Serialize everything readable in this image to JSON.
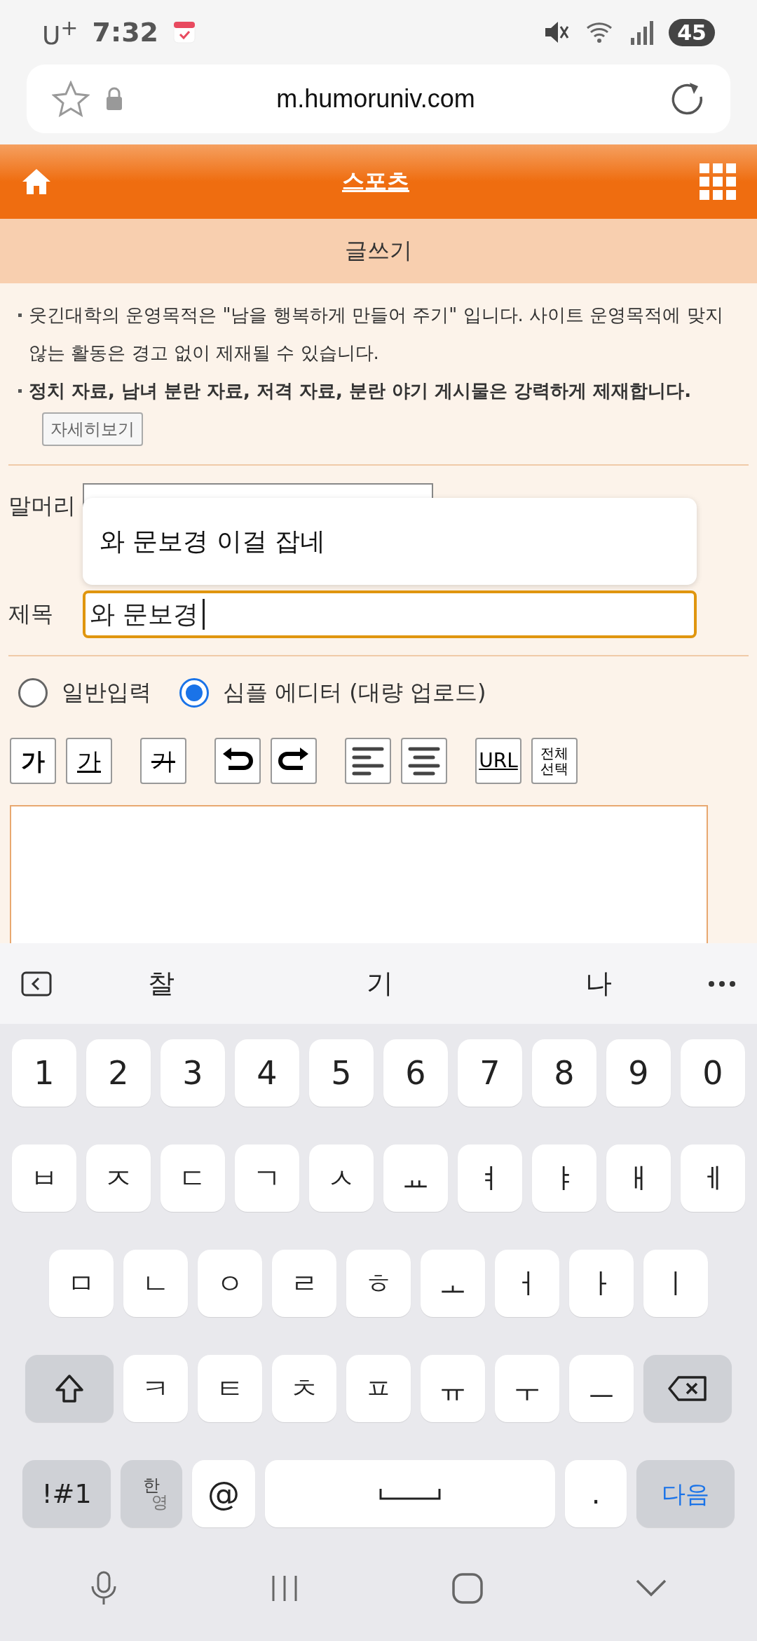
{
  "status_bar": {
    "carrier": "U$^{+}$",
    "time": "7:32",
    "battery": "45"
  },
  "browser": {
    "url": "m.humoruniv.com"
  },
  "header": {
    "title": "스포츠",
    "subtitle": "글쓰기"
  },
  "notices": [
    {
      "text": "웃긴대학의 운영목적은 \"남을 행복하게 만들어 주기\" 입니다. 사이트 운영목적에 맞지 않는 활동은 경고 없이 제재될 수 있습니다.",
      "bold": false
    },
    {
      "text": "정치 자료, 남녀 분란 자료, 저격 자료, 분란 야기 게시물은 강력하게 제재합니다.",
      "bold": true
    }
  ],
  "detail_button": "자세히보기",
  "form": {
    "category_label": "말머리",
    "title_label": "제목",
    "title_value": "와 문보경",
    "suggestion": "와 문보경 이걸 잡네"
  },
  "editor_modes": [
    {
      "label": "일반입력",
      "selected": false
    },
    {
      "label": "심플 에디터 (대량 업로드)",
      "selected": true
    }
  ],
  "toolbar": [
    {
      "kind": "bold",
      "label": "가"
    },
    {
      "kind": "underline",
      "label": "가"
    },
    {
      "kind": "strike",
      "label": "가"
    },
    {
      "kind": "undo"
    },
    {
      "kind": "redo"
    },
    {
      "kind": "align-left"
    },
    {
      "kind": "align-center"
    },
    {
      "kind": "url",
      "label": "URL"
    },
    {
      "kind": "select-all",
      "label": "전체 선택"
    }
  ],
  "keyboard": {
    "suggestions": [
      "찰",
      "기",
      "나"
    ],
    "rows": [
      [
        "1",
        "2",
        "3",
        "4",
        "5",
        "6",
        "7",
        "8",
        "9",
        "0"
      ],
      [
        "ㅂ",
        "ㅈ",
        "ㄷ",
        "ㄱ",
        "ㅅ",
        "ㅛ",
        "ㅕ",
        "ㅑ",
        "ㅐ",
        "ㅔ"
      ],
      [
        "ㅁ",
        "ㄴ",
        "ㅇ",
        "ㄹ",
        "ㅎ",
        "ㅗ",
        "ㅓ",
        "ㅏ",
        "ㅣ"
      ],
      [
        "ㅋ",
        "ㅌ",
        "ㅊ",
        "ㅍ",
        "ㅠ",
        "ㅜ",
        "ㅡ"
      ]
    ],
    "symbols": "!#1",
    "lang_top": "한",
    "lang_bottom": "영",
    "at": "@",
    "period": ".",
    "enter": "다음"
  }
}
